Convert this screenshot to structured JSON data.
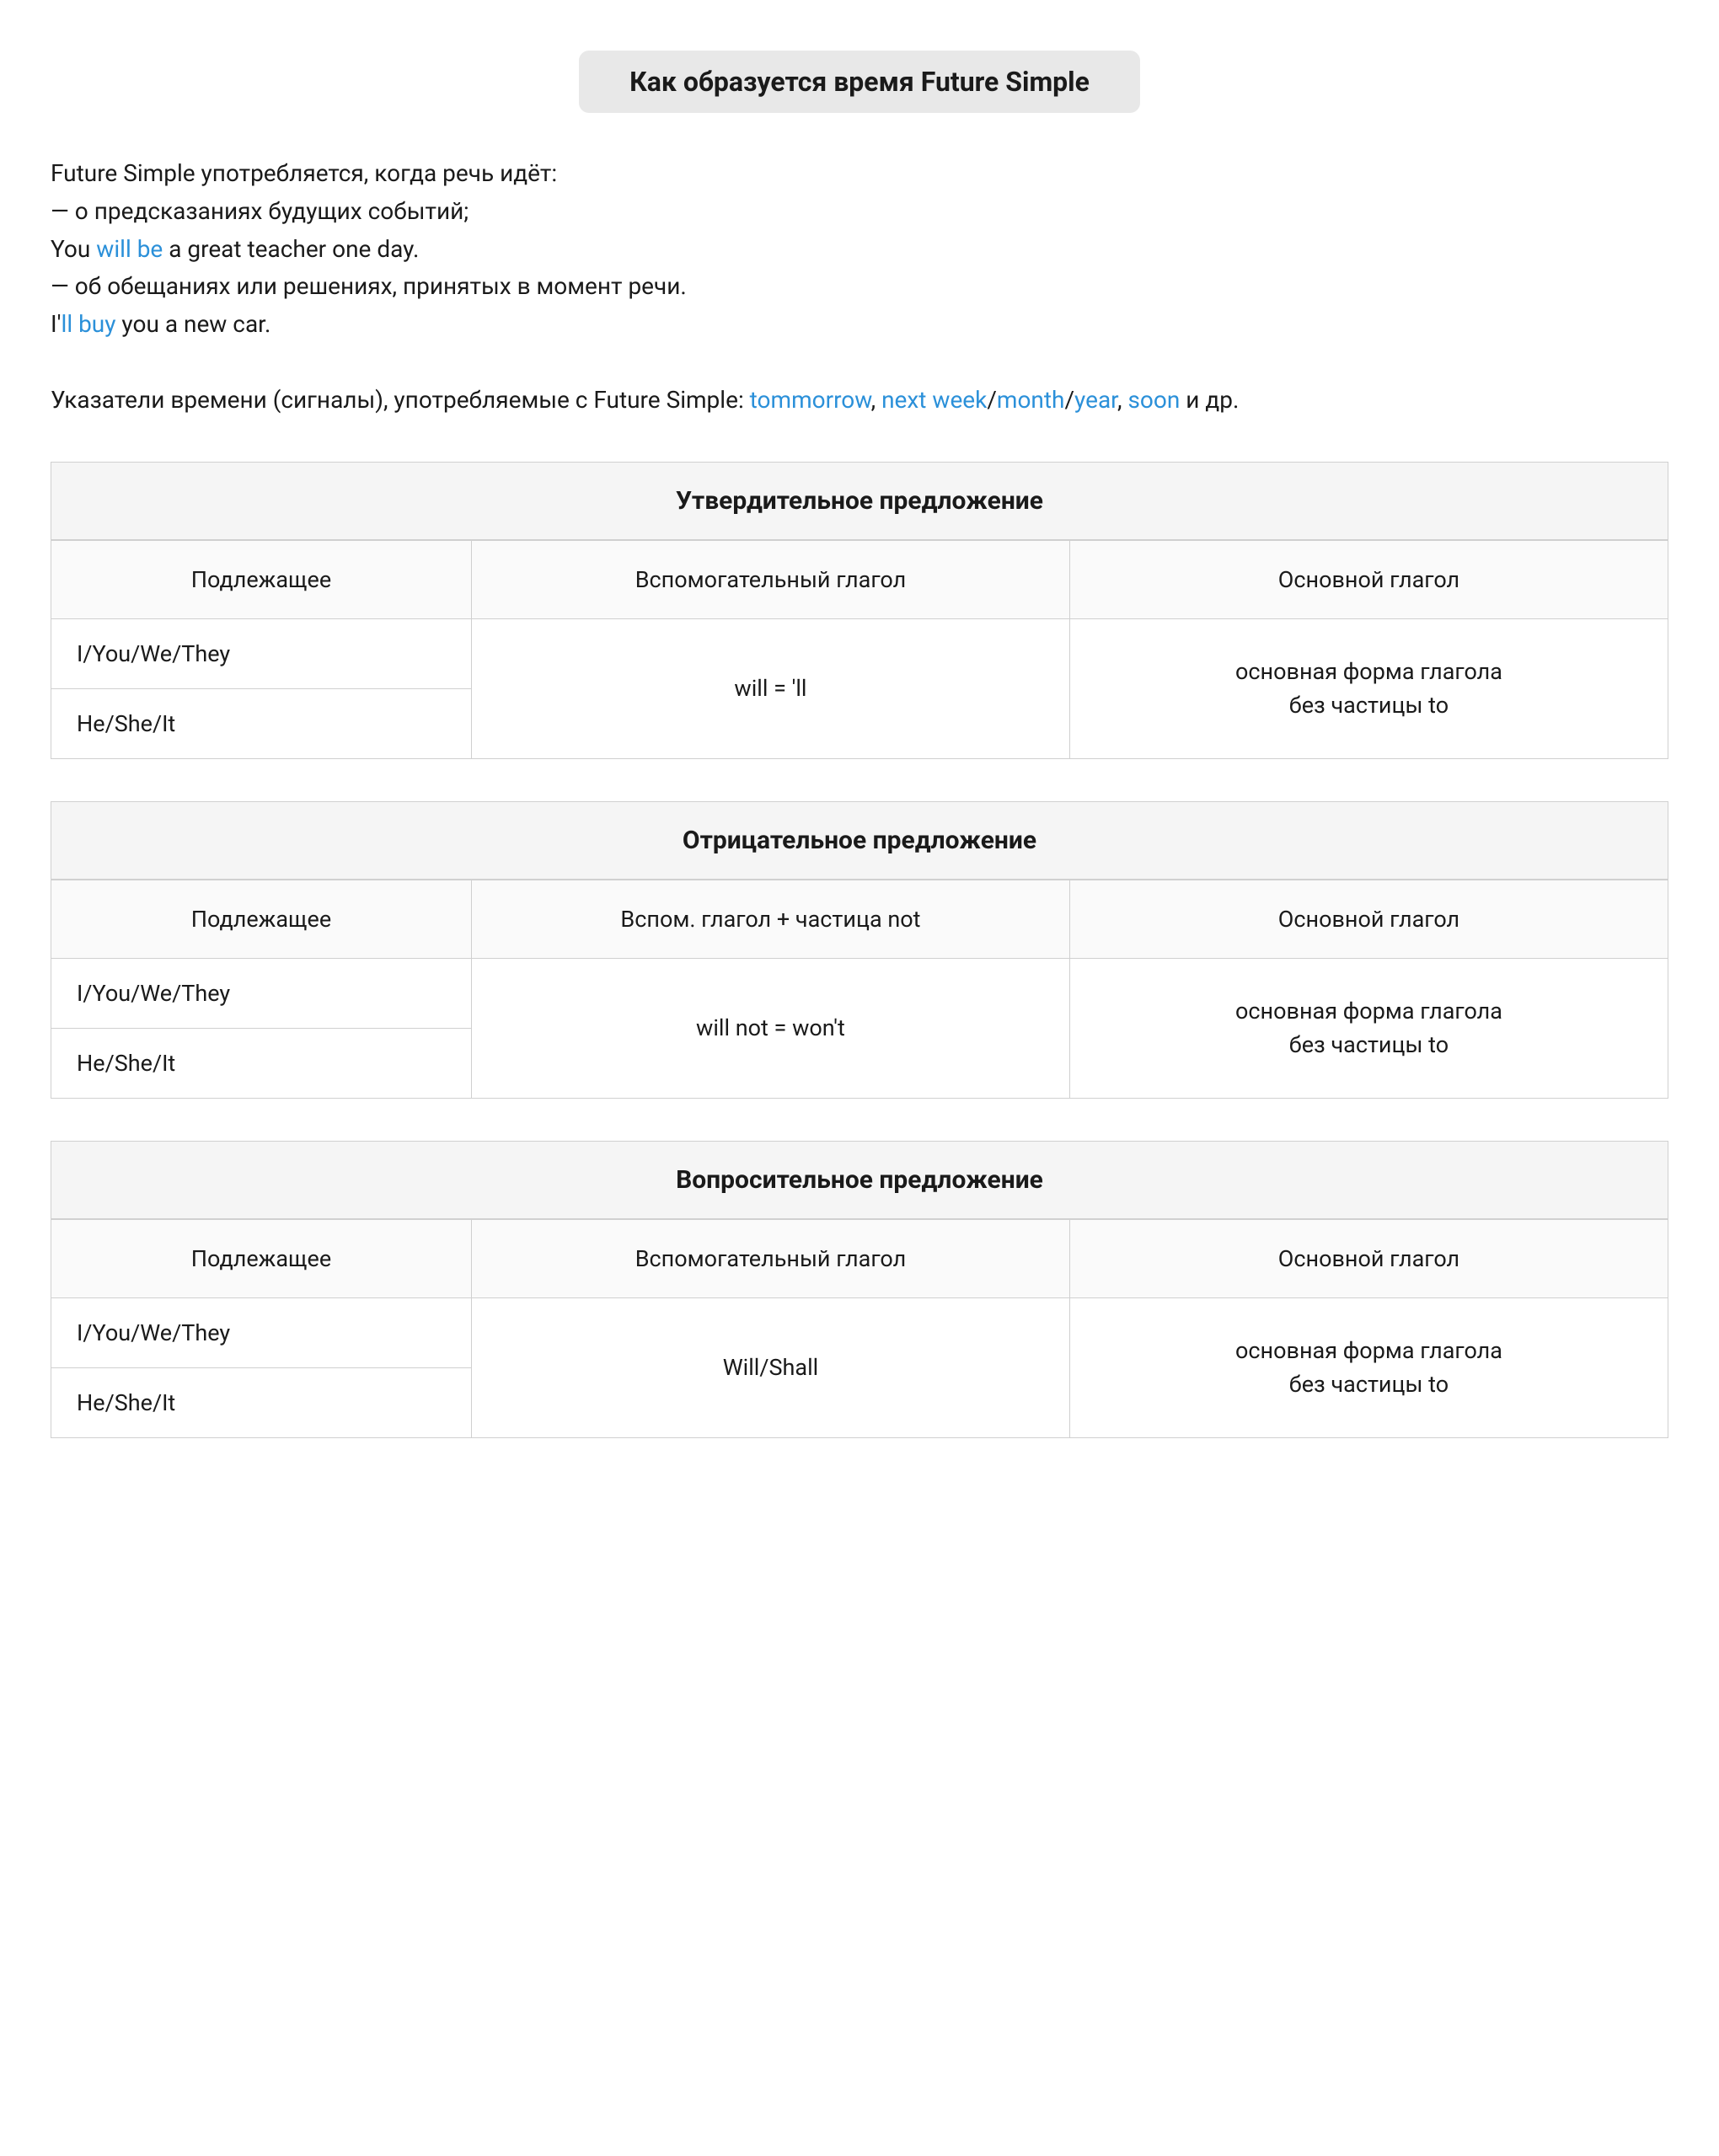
{
  "page": {
    "title": "Как образуется время Future Simple",
    "intro": {
      "line1": "Future Simple употребляется, когда речь идёт:",
      "line2": "— о предсказаниях будущих событий;",
      "line3_prefix": "You ",
      "line3_blue": "will be",
      "line3_suffix": " a great teacher one day.",
      "line4": "— об обещаниях или решениях, принятых в момент речи.",
      "line5_prefix": "I'",
      "line5_blue": "ll buy",
      "line5_suffix": " you a new car.",
      "line6_prefix": "Указатели времени (сигналы), употребляемые с Future Simple: ",
      "line6_blue1": "tommorrow",
      "line6_comma": ", ",
      "line6_blue2": "next week",
      "line6_slash1": "/",
      "line6_blue3": "month",
      "line6_slash2": "/",
      "line6_blue4": "year",
      "line6_comma2": ", ",
      "line6_blue5": "soon",
      "line6_suffix": " и др."
    },
    "affirmative": {
      "section_title": "Утвердительное предложение",
      "col1_header": "Подлежащее",
      "col2_header": "Вспомогательный глагол",
      "col3_header": "Основной глагол",
      "subject1": "I/You/We/They",
      "subject2": "He/She/It",
      "aux": "will = 'll",
      "main_verb": "основная форма глагола\nбез частицы to"
    },
    "negative": {
      "section_title": "Отрицательное предложение",
      "col1_header": "Подлежащее",
      "col2_header": "Вспом. глагол + частица not",
      "col3_header": "Основной глагол",
      "subject1": "I/You/We/They",
      "subject2": "He/She/It",
      "aux": "will not = won't",
      "main_verb": "основная форма глагола\nбез частицы to"
    },
    "interrogative": {
      "section_title": "Вопросительное предложение",
      "col1_header": "Подлежащее",
      "col2_header": "Вспомогательный глагол",
      "col3_header": "Основной глагол",
      "subject1": "I/You/We/They",
      "subject2": "He/She/It",
      "aux": "Will/Shall",
      "main_verb": "основная форма глагола\nбез частицы to"
    }
  }
}
